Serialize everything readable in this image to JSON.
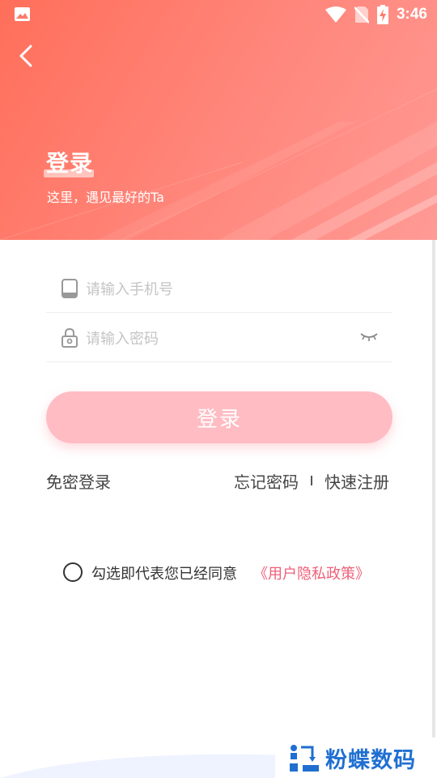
{
  "status_bar": {
    "time": "3:46",
    "icons": [
      "image-icon",
      "wifi-icon",
      "no-sim-icon",
      "battery-charging-icon"
    ]
  },
  "header": {
    "back_icon": "back-arrow-icon",
    "title": "登录",
    "subtitle": "这里，遇见最好的Ta"
  },
  "form": {
    "phone": {
      "icon": "phone-icon",
      "placeholder": "请输入手机号",
      "value": ""
    },
    "password": {
      "icon": "lock-icon",
      "placeholder": "请输入密码",
      "value": "",
      "toggle_icon": "eye-closed-icon"
    },
    "submit_label": "登录"
  },
  "links": {
    "sms_login": "免密登录",
    "forgot_password": "忘记密码",
    "register": "快速注册"
  },
  "agreement": {
    "checked": false,
    "text": "勾选即代表您已经同意",
    "policy_link": "《用户隐私政策》"
  },
  "watermark": {
    "text": "粉蝶数码"
  },
  "colors": {
    "hero_gradient_start": "#ff6f5a",
    "hero_gradient_end": "#ff9a95",
    "button_bg": "#ffbcc3",
    "policy_link": "#f0607a",
    "watermark_blue": "#1f6fd1"
  }
}
